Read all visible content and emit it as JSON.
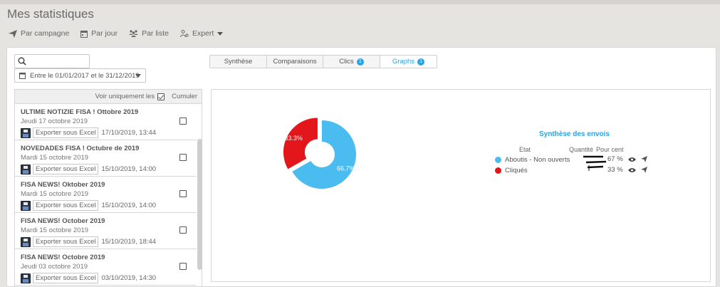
{
  "page": {
    "title": "Mes statistiques"
  },
  "toolbar": {
    "items": [
      {
        "label": "Par campagne",
        "icon": "send-icon"
      },
      {
        "label": "Par jour",
        "icon": "calendar-icon"
      },
      {
        "label": "Par liste",
        "icon": "people-icon"
      },
      {
        "label": "Expert",
        "icon": "user-settings-icon"
      }
    ]
  },
  "search": {
    "value": "",
    "placeholder": ""
  },
  "date_filter": {
    "label": "Entre le 01/01/2017 et le 31/12/2019"
  },
  "tabs": [
    {
      "label": "Synthèse"
    },
    {
      "label": "Comparaisons"
    },
    {
      "label": "Clics",
      "badge": "1"
    },
    {
      "label": "Graphs",
      "badge": "1",
      "active": true
    }
  ],
  "list": {
    "header_label": "Voir uniquement les",
    "header_checked": true,
    "cumuler": "Cumuler",
    "export_label": "Exporter sous Excel",
    "items": [
      {
        "name": "ULTIME NOTIZIE FISA ! Ottobre 2019",
        "date": "Jeudi 17 octobre 2019",
        "export_time": "17/10/2019, 13:44"
      },
      {
        "name": "NOVEDADES FISA ! Octubre de 2019",
        "date": "Mardi 15 octobre 2019",
        "export_time": "15/10/2019, 14:00"
      },
      {
        "name": "FISA NEWS! Oktober 2019",
        "date": "Mardi 15 octobre 2019",
        "export_time": "15/10/2019, 14:00"
      },
      {
        "name": "FISA NEWS! October 2019",
        "date": "Mardi 15 octobre 2019",
        "export_time": "15/10/2019, 18:44"
      },
      {
        "name": "FISA NEWS! Octobre 2019",
        "date": "Jeudi 03 octobre 2019",
        "export_time": "03/10/2019, 14:30"
      }
    ]
  },
  "synthese": {
    "title": "Synthèse des envois",
    "col_etat": "Etat",
    "col_quantite": "Quantité",
    "col_pourcent": "Pour cent",
    "rows": [
      {
        "label": "Aboutis - Non ouverts",
        "percent": "67 %",
        "color": "#4bbcf0"
      },
      {
        "label": "Cliqués",
        "percent": "33 %",
        "color": "#e3171b"
      }
    ]
  },
  "chart_data": {
    "type": "pie",
    "slices": [
      {
        "label": "Aboutis - Non ouverts",
        "value": 66.7,
        "display": "66.7%",
        "color": "#4bbcf0"
      },
      {
        "label": "Cliqués",
        "value": 33.3,
        "display": "33.3%",
        "color": "#e3171b"
      }
    ]
  }
}
